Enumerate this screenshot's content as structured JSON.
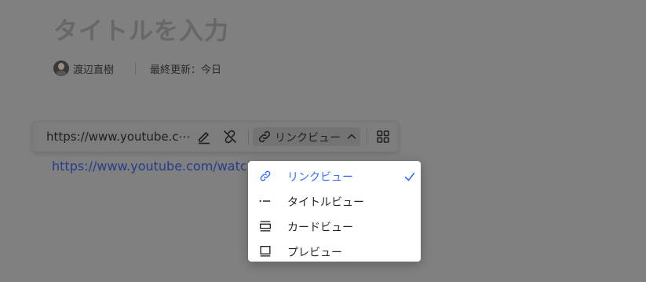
{
  "document": {
    "title_placeholder": "タイトルを入力",
    "author": "渡辺直樹",
    "last_updated": "最終更新：今日"
  },
  "link_toolbar": {
    "url": "https://www.youtube.c⋯",
    "view_select_label": "リンクビュー"
  },
  "link_text": "https://www.youtube.com/watch",
  "view_menu": {
    "items": [
      {
        "label": "リンクビュー",
        "icon": "link-icon",
        "selected": true
      },
      {
        "label": "タイトルビュー",
        "icon": "title-view-icon",
        "selected": false
      },
      {
        "label": "カードビュー",
        "icon": "card-view-icon",
        "selected": false
      },
      {
        "label": "プレビュー",
        "icon": "preview-icon",
        "selected": false
      }
    ]
  },
  "colors": {
    "accent": "#3370ff",
    "overlay": "#808080",
    "menu_background": "#ffffff"
  }
}
